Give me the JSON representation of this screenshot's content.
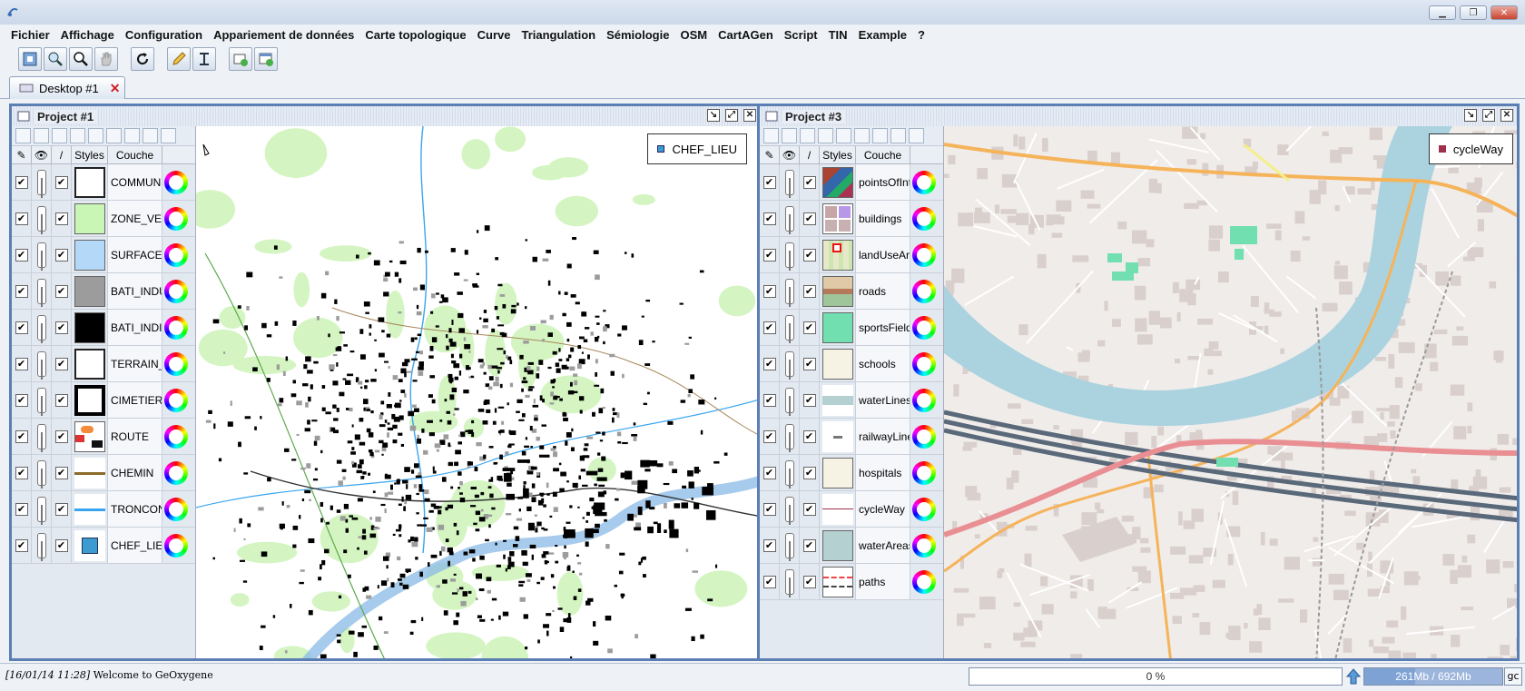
{
  "menu": [
    "Fichier",
    "Affichage",
    "Configuration",
    "Appariement de données",
    "Carte topologique",
    "Curve",
    "Triangulation",
    "Sémiologie",
    "OSM",
    "CartAGen",
    "Script",
    "TIN",
    "Example",
    "?"
  ],
  "toolbar_icons": [
    "zoom-extent-icon",
    "zoom-icon",
    "zoom-box-icon",
    "pan-hand-icon",
    "refresh-icon",
    "pencil-icon",
    "measure-icon",
    "new-project-icon",
    "new-frame-icon"
  ],
  "tab": {
    "label": "Desktop #1"
  },
  "project1": {
    "title": "Project #1",
    "head": {
      "styles": "Styles",
      "couche": "Couche"
    },
    "legend_label": "CHEF_LIEU",
    "legend_color": "#3d9bd1",
    "layers": [
      {
        "name": "COMMUNE",
        "swatch": "outline"
      },
      {
        "name": "ZONE_VEGETATION",
        "swatch": "#c9f5b5"
      },
      {
        "name": "SURFACE_EAU",
        "swatch": "#b4d8f7"
      },
      {
        "name": "BATI_INDUSTRIEL",
        "swatch": "#9c9c9c"
      },
      {
        "name": "BATI_INDIFFERENCIE",
        "swatch": "#000000"
      },
      {
        "name": "TERRAIN_SPORT",
        "swatch": "outline"
      },
      {
        "name": "CIMETIERE",
        "swatch": "thick"
      },
      {
        "name": "ROUTE",
        "swatch": "route"
      },
      {
        "name": "CHEMIN",
        "swatch": "line-brown"
      },
      {
        "name": "TRONCON_COURS_EAU",
        "swatch": "line-blue"
      },
      {
        "name": "CHEF_LIEU",
        "swatch": "square-blue"
      }
    ]
  },
  "project3": {
    "title": "Project #3",
    "head": {
      "styles": "Styles",
      "couche": "Couche"
    },
    "legend_label": "cycleWay",
    "legend_color": "#a0304a",
    "layers": [
      {
        "name": "pointsOfInterest",
        "swatch": "poi"
      },
      {
        "name": "buildings",
        "swatch": "buildings"
      },
      {
        "name": "landUseAreas",
        "swatch": "landuse"
      },
      {
        "name": "roads",
        "swatch": "roads"
      },
      {
        "name": "sportsFields",
        "swatch": "#72dfb1"
      },
      {
        "name": "schools",
        "swatch": "#f7f3e4"
      },
      {
        "name": "waterLines",
        "swatch": "waterline"
      },
      {
        "name": "railwayLines",
        "swatch": "rail"
      },
      {
        "name": "hospitals",
        "swatch": "#f7f3e4"
      },
      {
        "name": "cycleWay",
        "swatch": "cycle"
      },
      {
        "name": "waterAreas",
        "swatch": "#b5d0d0"
      },
      {
        "name": "paths",
        "swatch": "paths"
      }
    ]
  },
  "status": {
    "log_time": "[16/01/14 11:28]",
    "log_msg": "Welcome to GeOxygene",
    "progress": "0 %",
    "memory": "261Mb / 692Mb",
    "gc": "gc"
  }
}
